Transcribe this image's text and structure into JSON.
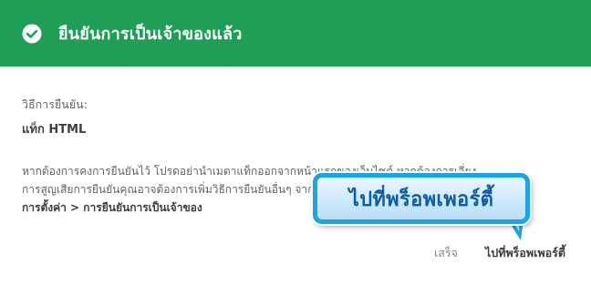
{
  "header": {
    "title": "ยืนยันการเป็นเจ้าของแล้ว",
    "icon": "check-circle-icon",
    "background": "#1e9e56"
  },
  "method": {
    "label": "วิธีการยืนยัน:",
    "value": "แท็ก HTML"
  },
  "description": {
    "line1": "หากต้องการคงการยืนยันไว้ โปรดอย่านำเมตาแท็กออกจากหน้าแรกของเว็บไซต์ หากต้องการเลี่ยง",
    "line2": "การสูญเสียการยืนยันคุณอาจต้องการเพิ่มวิธีการยืนยันอื่นๆ จาก",
    "path": "การตั้งค่า > การยืนยันการเป็นเจ้าของ"
  },
  "footer": {
    "done_label": "เสร็จ",
    "go_label": "ไปที่พร็อพเพอร์ตี้"
  },
  "callout": {
    "text": "ไปที่พร็อพเพอร์ตี้",
    "accent": "#1aa6e3"
  }
}
